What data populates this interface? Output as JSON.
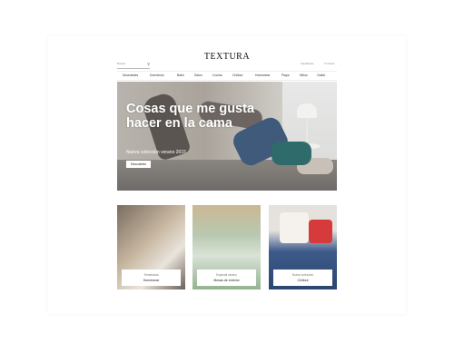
{
  "brand": {
    "logo": "TEXTURA"
  },
  "search": {
    "placeholder": "Buscar"
  },
  "utility": [
    {
      "label": "Identificate"
    },
    {
      "label": "Tu bolsa"
    }
  ],
  "nav": [
    {
      "label": "Novedades"
    },
    {
      "label": "Dormitorio"
    },
    {
      "label": "Baño"
    },
    {
      "label": "Salón"
    },
    {
      "label": "Cocina"
    },
    {
      "label": "Chillout"
    },
    {
      "label": "Homewear"
    },
    {
      "label": "Playa"
    },
    {
      "label": "Niños"
    },
    {
      "label": "Outlet"
    }
  ],
  "hero": {
    "title": "Cosas que me gusta hacer en la cama",
    "subtitle": "Nueva colección verano 2015",
    "button": "Descubrelo",
    "slides": 3,
    "active_slide": 2
  },
  "cards": [
    {
      "small": "Tendencias",
      "big": "Homewear"
    },
    {
      "small": "Especial verano",
      "big": "Mesas de exterior"
    },
    {
      "small": "Nueva colección",
      "big": "Chillout"
    }
  ],
  "colors": {
    "accent": "#ffffff",
    "text": "#222222"
  }
}
